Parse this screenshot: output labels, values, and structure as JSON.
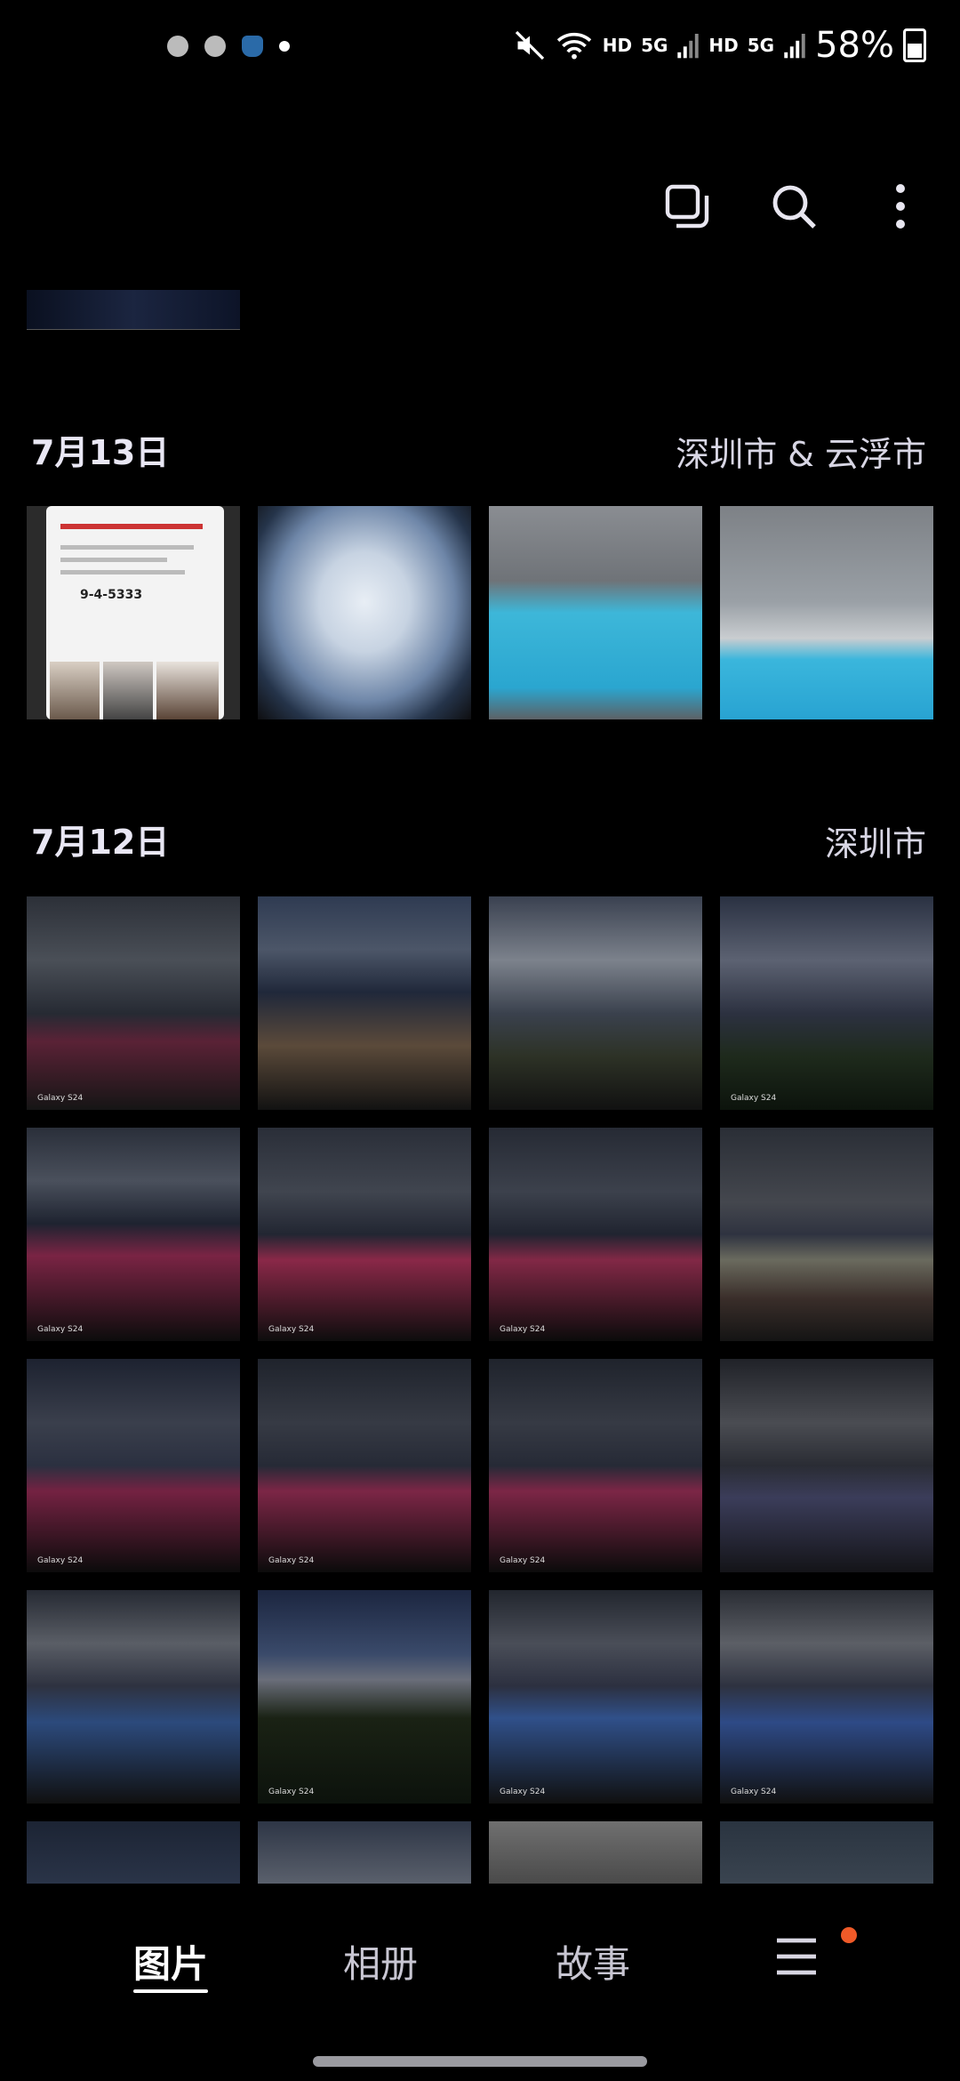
{
  "status_bar": {
    "hd1": "HD",
    "net1": "5G",
    "hd2": "HD",
    "net2": "5G",
    "battery": "58%",
    "icons": [
      "mute-icon",
      "wifi-icon",
      "signal-icon",
      "signal-icon",
      "battery-icon"
    ]
  },
  "toolbar": {
    "icons": [
      "select-icon",
      "search-icon",
      "more-vert-icon"
    ]
  },
  "sections": [
    {
      "date": "7月13日",
      "location": "深圳市 & 云浮市"
    },
    {
      "date": "7月12日",
      "location": "深圳市"
    }
  ],
  "watermark": "Galaxy S24",
  "phone_screenshot": {
    "order_number": "9-4-5333"
  },
  "bottom_nav": {
    "tabs": [
      "图片",
      "相册",
      "故事"
    ],
    "active": "图片",
    "menu_icon": "menu-icon",
    "badge_color": "#f05a28"
  }
}
